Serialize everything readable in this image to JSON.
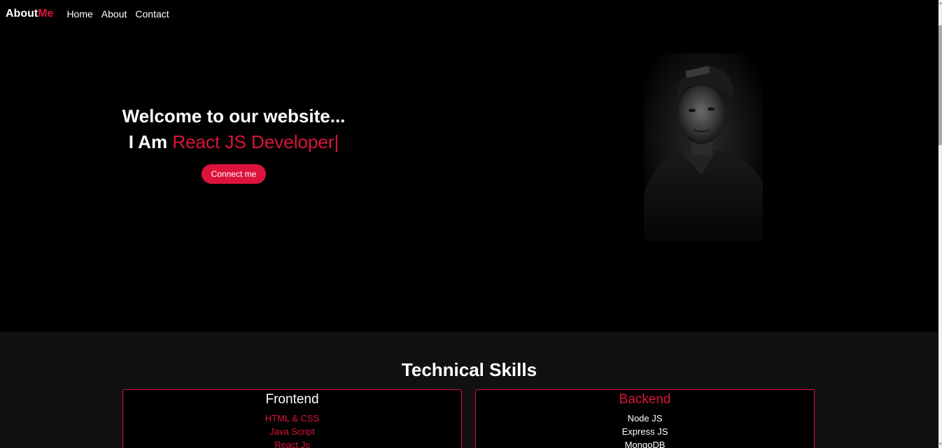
{
  "nav": {
    "brand_main": "About",
    "brand_accent": "Me",
    "links": [
      "Home",
      "About",
      "Contact"
    ]
  },
  "hero": {
    "welcome": "Welcome to our website...",
    "prefix": "I Am",
    "role": "React JS Developer",
    "cursor": "|",
    "button": "Connect me"
  },
  "skills": {
    "title": "Technical Skills",
    "frontend": {
      "title": "Frontend",
      "items": [
        "HTML & CSS",
        "Java Script",
        "React Js"
      ]
    },
    "backend": {
      "title": "Backend",
      "items": [
        "Node JS",
        "Express JS",
        "MongoDB"
      ]
    }
  },
  "colors": {
    "accent": "#dc143c",
    "background": "#000000",
    "section_background": "#111111"
  }
}
